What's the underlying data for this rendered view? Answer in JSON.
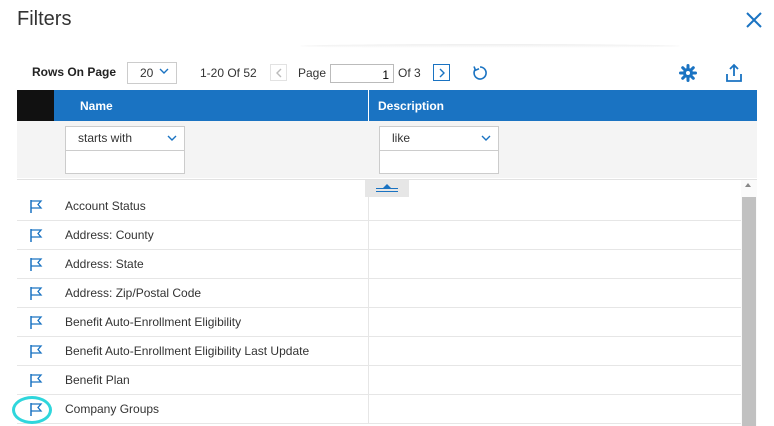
{
  "dialog": {
    "title": "Filters",
    "close_icon": "close-icon"
  },
  "toolbar": {
    "rows_label": "Rows On Page",
    "rows_value": "20",
    "range_text": "1-20 Of 52",
    "page_label": "Page",
    "page_value": "1",
    "of_pages": "Of 3",
    "icons": [
      "chevron-left-icon",
      "chevron-right-icon",
      "refresh-icon",
      "gear-icon",
      "export-icon"
    ]
  },
  "table": {
    "columns": [
      "Name",
      "Description"
    ],
    "filters": {
      "name_operator": "starts with",
      "description_operator": "like"
    },
    "rows": [
      {
        "name": "Account Status"
      },
      {
        "name": "Address: County"
      },
      {
        "name": "Address: State"
      },
      {
        "name": "Address: Zip/Postal Code"
      },
      {
        "name": "Benefit Auto-Enrollment Eligibility"
      },
      {
        "name": "Benefit Auto-Enrollment Eligibility Last Update"
      },
      {
        "name": "Benefit Plan"
      },
      {
        "name": "Company Groups"
      }
    ]
  },
  "colors": {
    "accent": "#1a73c2",
    "header_black": "#111111",
    "highlight": "#2fd6dc"
  }
}
